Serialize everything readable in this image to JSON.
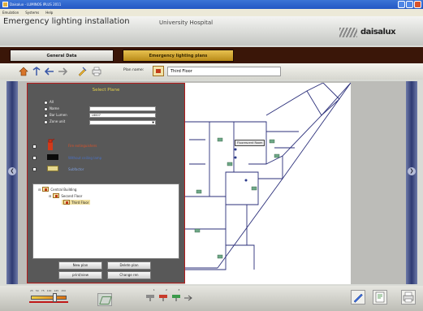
{
  "window": {
    "title": "Daisalux - LUMINOS IPLUS 2011",
    "menu": [
      "Emulation",
      "Systems",
      "Help"
    ]
  },
  "header": {
    "app_title": "Emergency lighting installation",
    "project_name": "University Hospital",
    "brand": "daisalux"
  },
  "tabs": [
    {
      "label": "General Data",
      "active": false
    },
    {
      "label": "Emergency lighting plans",
      "active": true
    }
  ],
  "toolbar": {
    "plan_name_label": "Plan name:",
    "plan_name_value": "Third Floor"
  },
  "dialog": {
    "title": "Select Plane",
    "options": [
      {
        "label": "All"
      },
      {
        "label": "Name"
      },
      {
        "label": "Bar Lumen",
        "value": "L6007"
      },
      {
        "label": "Zone unit"
      }
    ],
    "checks": [
      {
        "label": "Fire extinguishers",
        "color": "#d8522a"
      },
      {
        "label": "Without ceiling lamp",
        "color": "#4a72c8"
      },
      {
        "label": "Subfactor",
        "color": "#7fa0e0"
      }
    ],
    "tree": {
      "root": "Central Building",
      "child": "Second Floor",
      "grandchild": "Third Floor"
    },
    "buttons": {
      "new_plan": "New plan",
      "delete_plan": "Delete plan",
      "print": "print/view",
      "change": "Change ren"
    }
  },
  "canvas": {
    "label": "Fluorescent Room"
  },
  "bottom": {
    "zoom_scale": [
      "25",
      "50",
      "75",
      "100",
      "125",
      "150"
    ],
    "zoom_level": 0.68,
    "symbol_numbers": [
      "1",
      "2",
      "3"
    ]
  },
  "colors": {
    "accent_red": "#b51c1c",
    "tab_active": "#c89a20",
    "sidebar": "#2e3a72"
  }
}
